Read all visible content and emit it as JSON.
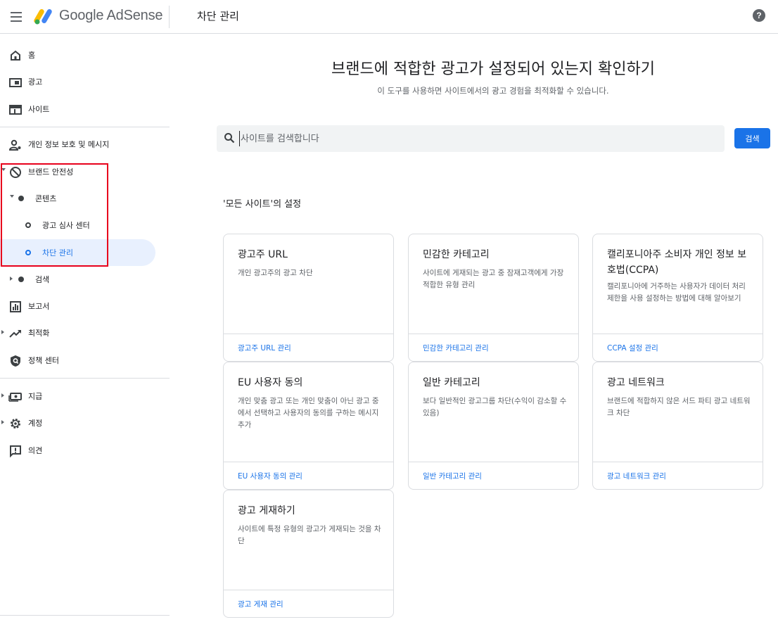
{
  "header": {
    "brand": "Google AdSense",
    "page_title": "차단 관리",
    "help_label": "?"
  },
  "sidebar": {
    "home": "홈",
    "ads": "광고",
    "sites": "사이트",
    "privacy": "개인 정보 보호 및 메시지",
    "brand_safety": "브랜드 안전성",
    "content": "콘텐츠",
    "ad_review": "광고 심사 센터",
    "blocking": "차단 관리",
    "search": "검색",
    "reports": "보고서",
    "optimization": "최적화",
    "policy": "정책 센터",
    "payments": "지급",
    "account": "계정",
    "feedback": "의견"
  },
  "hero": {
    "title": "브랜드에 적합한 광고가 설정되어 있는지 확인하기",
    "subtitle": "이 도구를 사용하면 사이트에서의 광고 경험을 최적화할 수 있습니다."
  },
  "search": {
    "placeholder": "사이트를 검색합니다",
    "button": "검색"
  },
  "section_title": "'모든 사이트'의 설정",
  "cards": [
    {
      "title": "광고주 URL",
      "desc": "개인 광고주의 광고 차단",
      "link": "광고주 URL 관리"
    },
    {
      "title": "민감한 카테고리",
      "desc": "사이트에 게재되는 광고 중 잠재고객에게 가장 적합한 유형 관리",
      "link": "민감한 카테고리 관리"
    },
    {
      "title": "캘리포니아주 소비자 개인 정보 보호법(CCPA)",
      "desc": "캘리포니아에 거주하는 사용자가 데이터 처리 제한을 사용 설정하는 방법에 대해 알아보기",
      "link": "CCPA 설정 관리"
    },
    {
      "title": "EU 사용자 동의",
      "desc": "개인 맞춤 광고 또는 개인 맞춤이 아닌 광고 중에서 선택하고 사용자의 동의를 구하는 메시지 추가",
      "link": "EU 사용자 동의 관리"
    },
    {
      "title": "일반 카테고리",
      "desc": "보다 일반적인 광고그룹 차단(수익이 감소할 수 있음)",
      "link": "일반 카테고리 관리"
    },
    {
      "title": "광고 네트워크",
      "desc": "브랜드에 적합하지 않은 서드 파티 광고 네트워크 차단",
      "link": "광고 네트워크 관리"
    },
    {
      "title": "광고 게재하기",
      "desc": "사이트에 특정 유형의 광고가 게재되는 것을 차단",
      "link": "광고 게재 관리"
    }
  ],
  "colors": {
    "accent": "#1a73e8",
    "active_bg": "#e8f0fe",
    "highlight_box": "#e8001c"
  }
}
